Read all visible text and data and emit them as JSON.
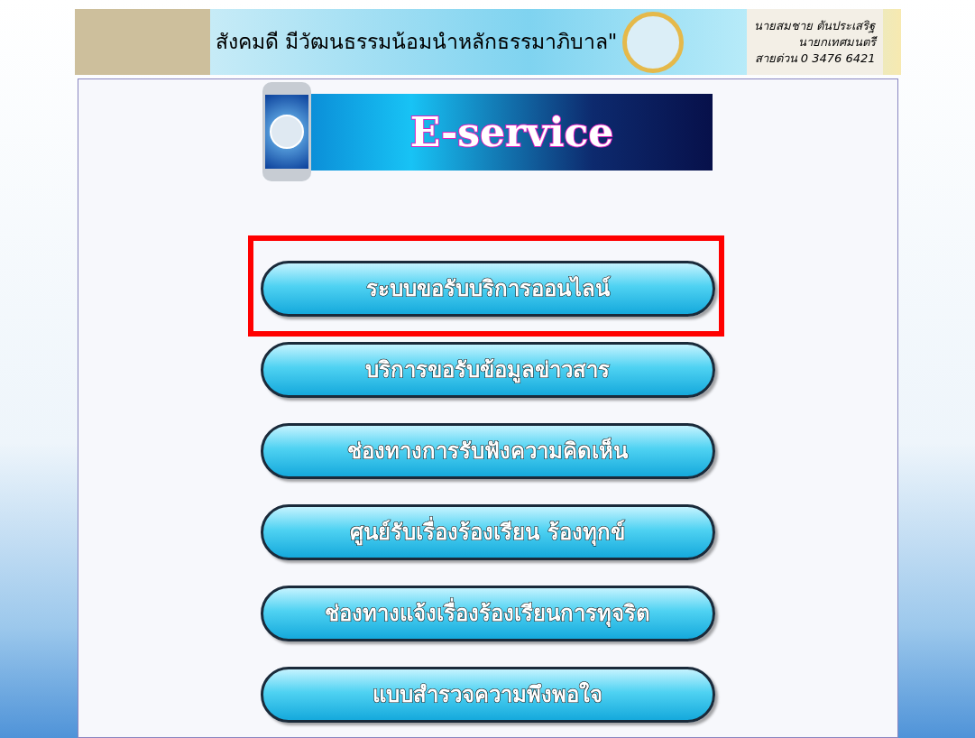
{
  "header": {
    "slogan": "สังคมดี มีวัฒนธรรมน้อมนำหลักธรรมาภิบาล\"",
    "contact_lines": [
      "นายสมชาย ตันประเสริฐ",
      "นายกเทศมนตรี",
      "สายด่วน 0 3476 6421"
    ]
  },
  "banner": {
    "title": "E-service"
  },
  "menu": [
    {
      "label": "ระบบขอรับบริการออนไลน์",
      "highlighted": true
    },
    {
      "label": "บริการขอรับข้อมูลข่าวสาร",
      "highlighted": false
    },
    {
      "label": "ช่องทางการรับฟังความคิดเห็น",
      "highlighted": false
    },
    {
      "label": "ศูนย์รับเรื่องร้องเรียน ร้องทุกข์",
      "highlighted": false
    },
    {
      "label": "ช่องทางแจ้งเรื่องร้องเรียนการทุจริต",
      "highlighted": false
    },
    {
      "label": "แบบสำรวจความพึงพอใจ",
      "highlighted": false
    }
  ]
}
